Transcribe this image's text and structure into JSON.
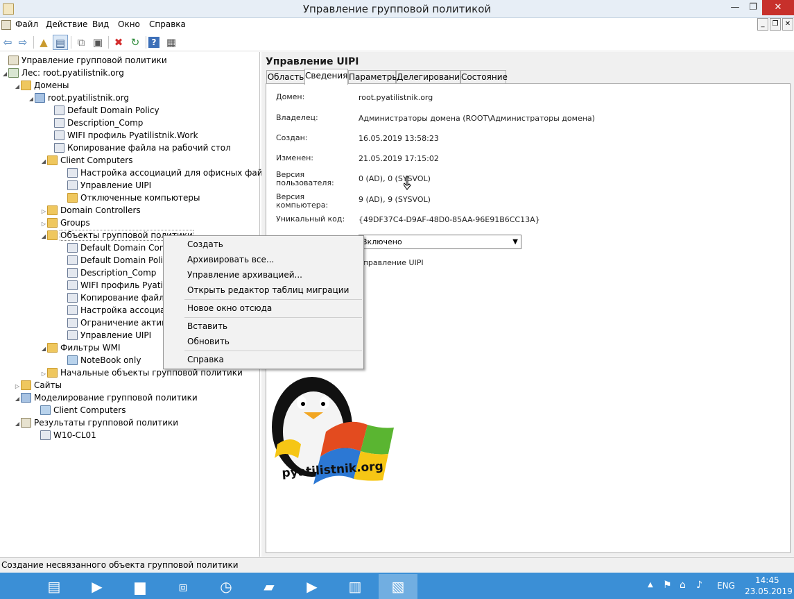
{
  "window": {
    "title": "Управление групповой политикой",
    "minimize": "—",
    "maximize": "❐",
    "close": "✕"
  },
  "menu": [
    "Файл",
    "Действие",
    "Вид",
    "Окно",
    "Справка"
  ],
  "tree": [
    {
      "label": "Управление групповой политики",
      "icon": "root-icon"
    },
    {
      "label": "Лес: root.pyatilistnik.org",
      "icon": "forest-icon"
    },
    {
      "label": "Домены",
      "icon": "folder-icon"
    },
    {
      "label": "root.pyatilistnik.org",
      "icon": "domain-icon"
    },
    {
      "label": "Default Domain Policy",
      "icon": "gpo-link-icon"
    },
    {
      "label": "Description_Comp",
      "icon": "gpo-link-icon"
    },
    {
      "label": "WIFI профиль Pyatilistnik.Work",
      "icon": "gpo-link-icon"
    },
    {
      "label": "Копирование файла на рабочий стол",
      "icon": "gpo-link-icon"
    },
    {
      "label": "Client Computers",
      "icon": "ou-icon"
    },
    {
      "label": "Настройка ассоциаций для офисных файлов",
      "icon": "gpo-link-icon"
    },
    {
      "label": "Управление UIPI",
      "icon": "gpo-link-icon"
    },
    {
      "label": "Отключенные компьютеры",
      "icon": "ou-icon"
    },
    {
      "label": "Domain Controllers",
      "icon": "ou-icon"
    },
    {
      "label": "Groups",
      "icon": "ou-icon"
    },
    {
      "label": "Объекты групповой политики",
      "icon": "folder-icon"
    },
    {
      "label": "Default Domain Contro",
      "icon": "gpo-icon"
    },
    {
      "label": "Default Domain Policy",
      "icon": "gpo-icon"
    },
    {
      "label": "Description_Comp",
      "icon": "gpo-icon"
    },
    {
      "label": "WIFI профиль Pyatilist",
      "icon": "gpo-icon"
    },
    {
      "label": "Копирование файла н",
      "icon": "gpo-icon"
    },
    {
      "label": "Настройка ассоциаци",
      "icon": "gpo-icon"
    },
    {
      "label": "Ограничение активно",
      "icon": "gpo-icon"
    },
    {
      "label": "Управление UIPI",
      "icon": "gpo-icon"
    },
    {
      "label": "Фильтры WMI",
      "icon": "folder-icon"
    },
    {
      "label": "NoteBook only",
      "icon": "wmi-filter-icon"
    },
    {
      "label": "Начальные объекты групповой политики",
      "icon": "folder-icon"
    },
    {
      "label": "Сайты",
      "icon": "sites-icon"
    },
    {
      "label": "Моделирование групповой политики",
      "icon": "modeling-icon"
    },
    {
      "label": "Client Computers",
      "icon": "modeling-item-icon"
    },
    {
      "label": "Результаты групповой политики",
      "icon": "results-icon"
    },
    {
      "label": "W10-CL01",
      "icon": "results-item-icon"
    }
  ],
  "details": {
    "title": "Управление UIPI",
    "tabs": [
      "Область",
      "Сведения",
      "Параметры",
      "Делегирование",
      "Состояние"
    ],
    "active_tab": "Сведения",
    "fields": [
      {
        "label": "Домен:",
        "value": "root.pyatilistnik.org"
      },
      {
        "label": "Владелец:",
        "value": "Администраторы домена (ROOT\\Администраторы домена)"
      },
      {
        "label": "Создан:",
        "value": "16.05.2019 13:58:23"
      },
      {
        "label": "Изменен:",
        "value": "21.05.2019 17:15:02"
      },
      {
        "label": "Версия пользователя:",
        "value": "0 (AD), 0 (SYSVOL)"
      },
      {
        "label": "Версия компьютера:",
        "value": "9 (AD), 9 (SYSVOL)"
      },
      {
        "label": "Уникальный код:",
        "value": "{49DF37C4-D9AF-48D0-85AA-96E91B6CC13A}"
      }
    ],
    "status_value": "Включено",
    "comment_value": "Управление UIPI"
  },
  "context_menu": {
    "items": [
      "Создать",
      "Архивировать все...",
      "Управление архивацией...",
      "Открыть редактор таблиц миграции",
      "Новое окно отсюда",
      "Вставить",
      "Обновить",
      "Справка"
    ]
  },
  "statusbar": {
    "text": "Создание несвязанного объекта групповой политики"
  },
  "watermark": {
    "text": "pyatilistnik.org"
  },
  "taskbar": {
    "lang": "ENG",
    "time": "14:45",
    "date": "23.05.2019"
  }
}
